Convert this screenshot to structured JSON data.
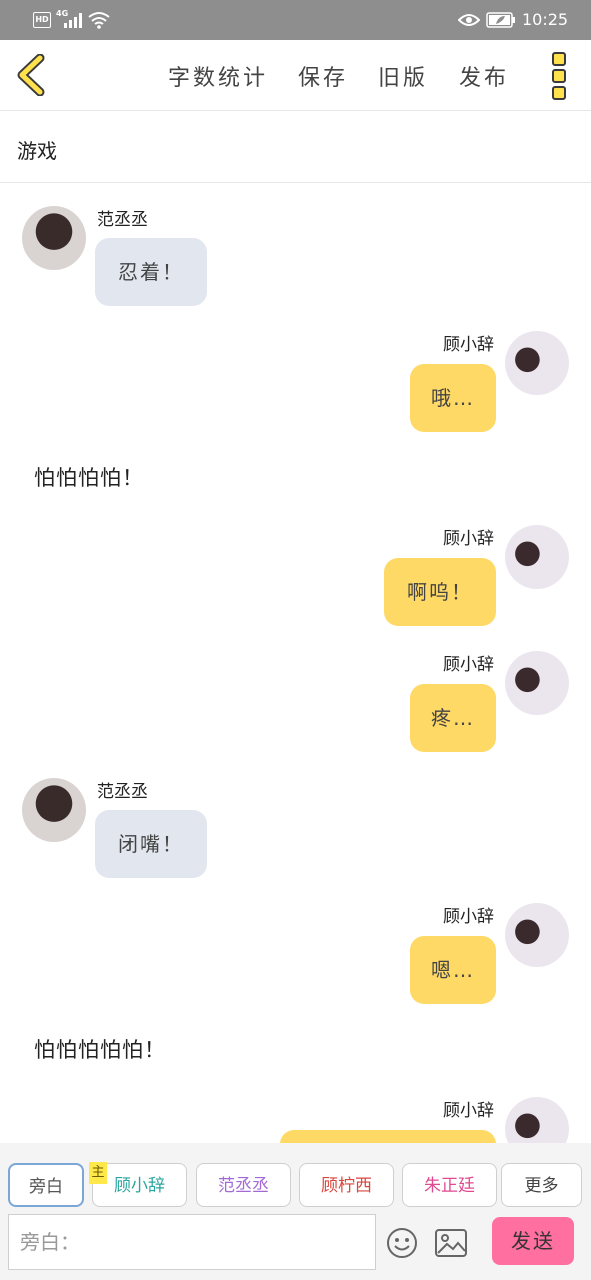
{
  "status_bar": {
    "hd": "HD",
    "network": "4G",
    "time": "10:25",
    "icons": [
      "signal-icon",
      "wifi-icon",
      "eye-icon",
      "battery-icon"
    ]
  },
  "toolbar": {
    "back_icon": "chevron-left-icon",
    "actions": [
      "字数统计",
      "保存",
      "旧版",
      "发布"
    ],
    "more_icon": "three-squares-menu-icon",
    "accent_color": "#ffe14d"
  },
  "title": "游戏",
  "chat": {
    "messages": [
      {
        "type": "left",
        "name": "范丞丞",
        "text": "忍着！"
      },
      {
        "type": "right",
        "name": "顾小辞",
        "text": "哦…"
      },
      {
        "type": "narration",
        "text": "怕怕怕怕！"
      },
      {
        "type": "right",
        "name": "顾小辞",
        "text": "啊呜！"
      },
      {
        "type": "right",
        "name": "顾小辞",
        "text": "疼…"
      },
      {
        "type": "left",
        "name": "范丞丞",
        "text": "闭嘴！"
      },
      {
        "type": "right",
        "name": "顾小辞",
        "text": "嗯…"
      },
      {
        "type": "narration",
        "text": "怕怕怕怕怕！"
      },
      {
        "type": "right",
        "name": "顾小辞",
        "text": ""
      }
    ]
  },
  "composer": {
    "roles": [
      {
        "label": "旁白",
        "color": "#555555",
        "selected": true
      },
      {
        "label": "顾小辞",
        "color": "#2aa6a0",
        "badge": "主"
      },
      {
        "label": "范丞丞",
        "color": "#a36ad6"
      },
      {
        "label": "顾柠西",
        "color": "#d9463e"
      },
      {
        "label": "朱正廷",
        "color": "#e04a8f"
      },
      {
        "label": "更多",
        "color": "#444444"
      }
    ],
    "input_placeholder": "旁白：",
    "emoji_icon": "smiley-icon",
    "image_icon": "image-icon",
    "send_label": "发送",
    "send_color": "#ff6fa0"
  }
}
